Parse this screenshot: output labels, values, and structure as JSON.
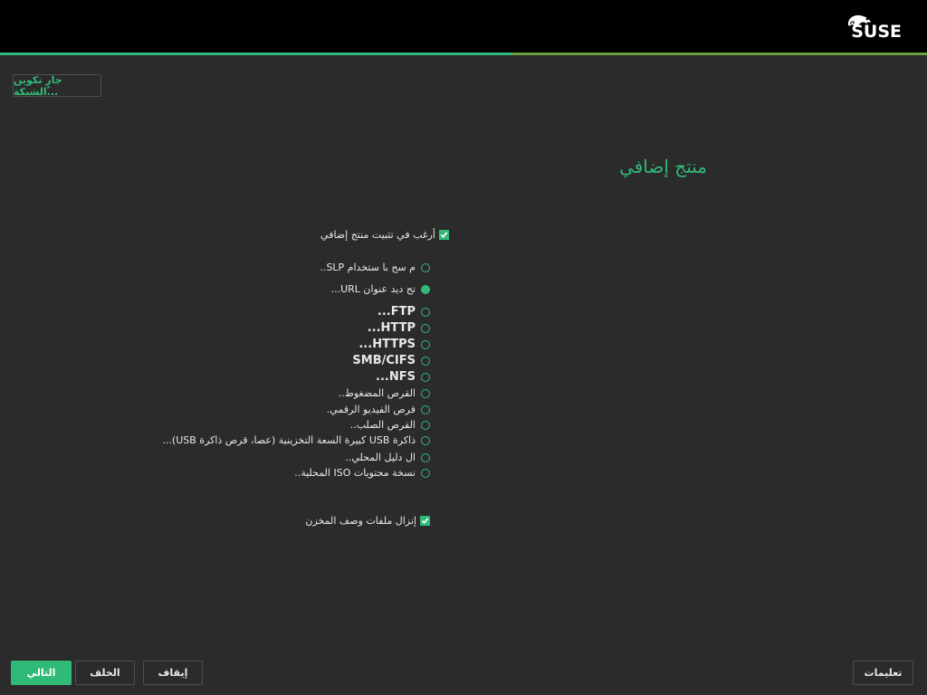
{
  "brand": {
    "logo_text": "SUSE"
  },
  "header": {
    "network_button": "جارٍ تكوين الشبكة..."
  },
  "progress": {
    "fraction": 0.553
  },
  "main": {
    "title": "منتج إضافي",
    "install_addon_checkbox": {
      "label": "أرغب في تثبيت منتج إضافي",
      "checked": true
    },
    "sources": [
      {
        "label": "م سح با ستخدام SLP..",
        "selected": false
      },
      {
        "label": "تح ديد عنوان URL...",
        "selected": true
      },
      {
        "label": "FTP...",
        "selected": false
      },
      {
        "label": "HTTP...",
        "selected": false
      },
      {
        "label": "HTTPS...",
        "selected": false
      },
      {
        "label": "SMB/CIFS",
        "selected": false
      },
      {
        "label": "NFS...",
        "selected": false
      },
      {
        "label": "القرص المضغوط..",
        "selected": false
      },
      {
        "label": "قرص الفيديو الرقمي.",
        "selected": false
      },
      {
        "label": "القرص الصلب..",
        "selected": false
      },
      {
        "label": "ذاكرة USB كبيرة السعة التخزينية (عصا، قرص ذاكرة USB)...",
        "selected": false
      },
      {
        "label": "ال دليل المحلي..",
        "selected": false
      },
      {
        "label": "نسخة محتويات ISO المحلية..",
        "selected": false
      }
    ],
    "download_repo_checkbox": {
      "label": "إنزال ملفات وصف المخزن",
      "checked": true
    }
  },
  "footer": {
    "help": "تعليمات",
    "abort": "إيقاف",
    "back": "الخلف",
    "next": "التالي"
  },
  "colors": {
    "accent": "#30ba78",
    "background": "#2b2b2b",
    "topbar": "#000000"
  }
}
